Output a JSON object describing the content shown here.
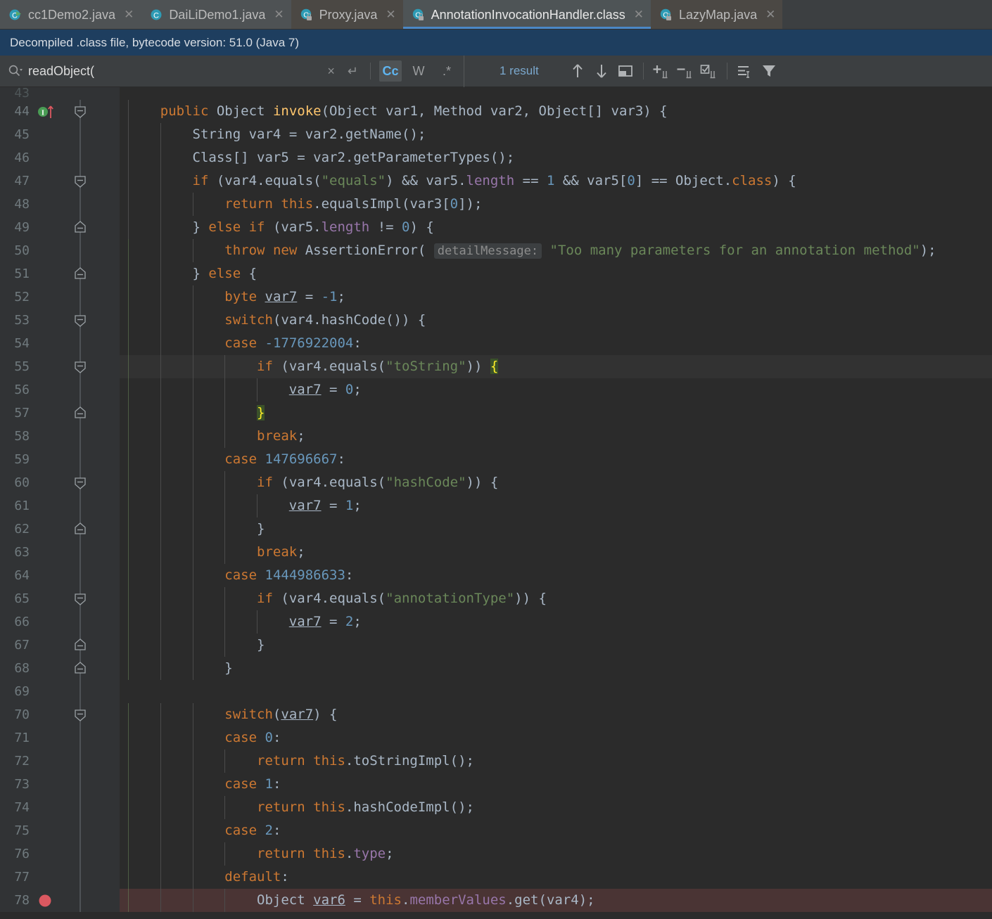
{
  "tabs": [
    {
      "label": "cc1Demo2.java",
      "icon": "java-class-run-icon",
      "state": "normal",
      "closable": true
    },
    {
      "label": "DaiLiDemo1.java",
      "icon": "java-class-icon",
      "state": "normal",
      "closable": true
    },
    {
      "label": "Proxy.java",
      "icon": "java-class-locked-icon",
      "state": "alt",
      "closable": true
    },
    {
      "label": "AnnotationInvocationHandler.class",
      "icon": "java-class-locked-icon",
      "state": "selected",
      "closable": true
    },
    {
      "label": "LazyMap.java",
      "icon": "java-class-locked-icon",
      "state": "alt",
      "closable": true
    }
  ],
  "notification": {
    "message": "Decompiled .class file, bytecode version: 51.0 (Java 7)"
  },
  "search": {
    "query": "readObject(",
    "placeholder": "Search",
    "result_count": "1 result",
    "clear_label": "×",
    "newline_label": "↵",
    "toggles": [
      {
        "name": "match-case-toggle",
        "label": "Cc",
        "active": true
      },
      {
        "name": "words-toggle",
        "label": "W",
        "active": false
      },
      {
        "name": "regex-toggle",
        "label": ".*",
        "active": false
      }
    ],
    "actions": [
      {
        "name": "find-previous-icon",
        "label": "↑"
      },
      {
        "name": "find-next-icon",
        "label": "↓"
      },
      {
        "name": "open-in-find-window-icon",
        "label": "▭"
      },
      {
        "name": "add-selection-icon",
        "label": "+"
      },
      {
        "name": "remove-selection-icon",
        "label": "−"
      },
      {
        "name": "select-all-occurrences-icon",
        "label": "☑"
      },
      {
        "name": "search-in-selection-icon",
        "label": "≡"
      },
      {
        "name": "filter-icon",
        "label": "▼"
      }
    ]
  },
  "colors": {
    "editor_bg": "#2b2b2b",
    "gutter_bg": "#313335",
    "tab_selected_underline": "#4a88c7",
    "notification_bg": "#1e3e5f",
    "breakpoint": "#db5860",
    "keyword": "#cc7832",
    "string": "#6a8759",
    "number": "#6897bb",
    "field": "#9876aa",
    "method": "#ffc66d",
    "default_text": "#a9b7c6",
    "brace_highlight_bg": "#3b5229",
    "brace_highlight_fg": "#ffef28",
    "current_line_bg": "#323232",
    "breakpoint_line_bg": "#4a3434"
  },
  "editor": {
    "first_visible_line": 43,
    "current_line": 55,
    "breakpoint_line": 78,
    "lines": [
      {
        "n": 43,
        "text": "",
        "partial": true
      },
      {
        "n": 44,
        "text": "    public Object invoke(Object var1, Method var2, Object[] var3) {",
        "gutter": "method-run-icon",
        "fold": "open"
      },
      {
        "n": 45,
        "text": "        String var4 = var2.getName();"
      },
      {
        "n": 46,
        "text": "        Class[] var5 = var2.getParameterTypes();"
      },
      {
        "n": 47,
        "text": "        if (var4.equals(\"equals\") && var5.length == 1 && var5[0] == Object.class) {",
        "fold": "open"
      },
      {
        "n": 48,
        "text": "            return this.equalsImpl(var3[0]);"
      },
      {
        "n": 49,
        "text": "        } else if (var5.length != 0) {",
        "fold": "close"
      },
      {
        "n": 50,
        "text": "            throw new AssertionError( detailMessage: \"Too many parameters for an annotation method\");",
        "hint": "detailMessage:"
      },
      {
        "n": 51,
        "text": "        } else {",
        "fold": "close"
      },
      {
        "n": 52,
        "text": "            byte var7 = -1;"
      },
      {
        "n": 53,
        "text": "            switch(var4.hashCode()) {",
        "fold": "open"
      },
      {
        "n": 54,
        "text": "            case -1776922004:"
      },
      {
        "n": 55,
        "text": "                if (var4.equals(\"toString\")) {",
        "fold": "open",
        "current": true,
        "brace": "open"
      },
      {
        "n": 56,
        "text": "                    var7 = 0;"
      },
      {
        "n": 57,
        "text": "                }",
        "fold": "close",
        "brace": "close"
      },
      {
        "n": 58,
        "text": "                break;"
      },
      {
        "n": 59,
        "text": "            case 147696667:"
      },
      {
        "n": 60,
        "text": "                if (var4.equals(\"hashCode\")) {",
        "fold": "open"
      },
      {
        "n": 61,
        "text": "                    var7 = 1;"
      },
      {
        "n": 62,
        "text": "                }",
        "fold": "close"
      },
      {
        "n": 63,
        "text": "                break;"
      },
      {
        "n": 64,
        "text": "            case 1444986633:"
      },
      {
        "n": 65,
        "text": "                if (var4.equals(\"annotationType\")) {",
        "fold": "open"
      },
      {
        "n": 66,
        "text": "                    var7 = 2;"
      },
      {
        "n": 67,
        "text": "                }",
        "fold": "close"
      },
      {
        "n": 68,
        "text": "            }",
        "fold": "close"
      },
      {
        "n": 69,
        "text": ""
      },
      {
        "n": 70,
        "text": "            switch(var7) {",
        "fold": "open"
      },
      {
        "n": 71,
        "text": "            case 0:"
      },
      {
        "n": 72,
        "text": "                return this.toStringImpl();"
      },
      {
        "n": 73,
        "text": "            case 1:"
      },
      {
        "n": 74,
        "text": "                return this.hashCodeImpl();"
      },
      {
        "n": 75,
        "text": "            case 2:"
      },
      {
        "n": 76,
        "text": "                return this.type;"
      },
      {
        "n": 77,
        "text": "            default:"
      },
      {
        "n": 78,
        "text": "                Object var6 = this.memberValues.get(var4);",
        "breakpoint": true
      }
    ]
  }
}
